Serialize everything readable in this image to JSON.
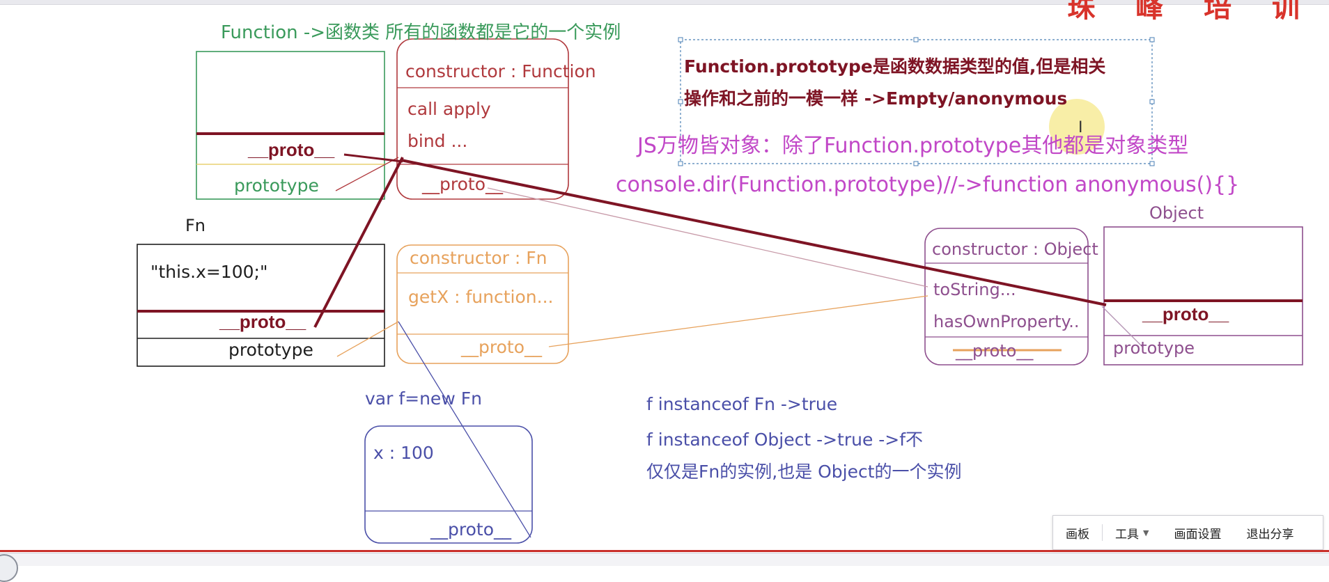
{
  "watermark": "珠 峰 培 训",
  "function_class": {
    "caption": "Function ->函数类   所有的函数都是它的一个实例",
    "proto_label": "__proto__",
    "prototype_label": "prototype"
  },
  "function_prototype": {
    "constructor": "constructor : Function",
    "methods_line1": "call   apply",
    "methods_line2": "bind ...",
    "proto_label": "__proto__"
  },
  "fn_class": {
    "name": "Fn",
    "body": "\"this.x=100;\"",
    "proto_label": "__proto__",
    "prototype_label": "prototype"
  },
  "fn_prototype": {
    "constructor": "constructor : Fn",
    "method": "getX : function...",
    "proto_label": "__proto__"
  },
  "instance": {
    "caption": "var f=new Fn",
    "prop": "x  : 100",
    "proto_label": "__proto__"
  },
  "object_prototype": {
    "constructor": "constructor : Object",
    "method1": "toString...",
    "method2": "hasOwnProperty..",
    "proto_label": "__proto__"
  },
  "object_class": {
    "name": "Object",
    "proto_label": "__proto__",
    "prototype_label": "prototype"
  },
  "note_box": {
    "line1": "Function.prototype是函数数据类型的值,但是相关",
    "line2": "操作和之前的一模一样 ->Empty/anonymous"
  },
  "pink_notes": {
    "line1": "JS万物皆对象：除了Function.prototype其他都是对象类型",
    "line2": "console.dir(Function.prototype)//->function anonymous(){}"
  },
  "blue_notes": {
    "line1": "f instanceof Fn ->true",
    "line2": "f instanceof Object ->true    ->f不",
    "line3": "仅仅是Fn的实例,也是 Object的一个实例"
  },
  "toolbar": {
    "items": [
      "画板",
      "工具",
      "画面设置",
      "退出分享"
    ]
  },
  "colors": {
    "green": "#3a9a5b",
    "darkred": "#7e1424",
    "orange": "#e7a25c",
    "purple": "#8e4f8e",
    "navy": "#4a4fa8",
    "pink": "#c147c7",
    "box_red": "#b0393d"
  }
}
